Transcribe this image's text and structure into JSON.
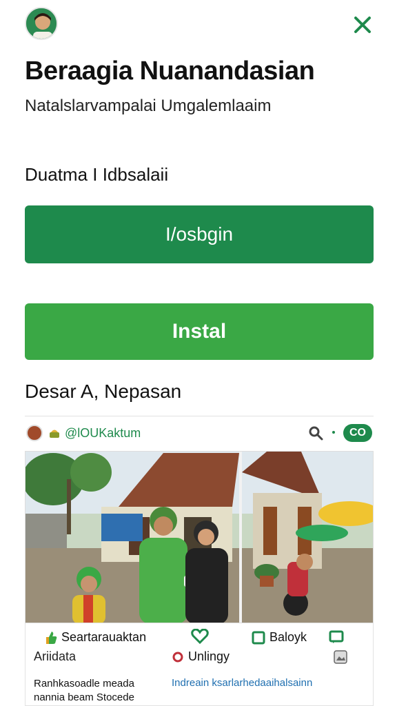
{
  "header": {
    "title": "Beraagia Nuanandasian",
    "subtitle": "Natalslarvampalai Umgalemlaaim"
  },
  "section": {
    "label": "Duatma I Idbsalaii"
  },
  "buttons": {
    "primary_label": "I/osbgin",
    "secondary_label": "Instal"
  },
  "location": {
    "text": "Desar A, Nepasan"
  },
  "post": {
    "handle": "@lOUKaktum",
    "badge": "CO",
    "actions": {
      "like_label": "Seartarauaktan",
      "box_label": "Baloyk",
      "secondary_label": "Ariidata",
      "hint_label": "Unlingy"
    },
    "caption_left": "Ranhkasoadle meada nannia beam Stocede",
    "caption_right": "Indreain ksarlarhedaaihalsainn"
  },
  "colors": {
    "primary": "#1e8a4c",
    "secondary": "#3aa845",
    "link": "#1f6fb0"
  },
  "icons": [
    "avatar",
    "close-icon",
    "pot-icon",
    "search-icon",
    "thumbs-up-icon",
    "heart-icon",
    "checkbox-icon",
    "message-icon",
    "radio-icon",
    "image-icon"
  ]
}
